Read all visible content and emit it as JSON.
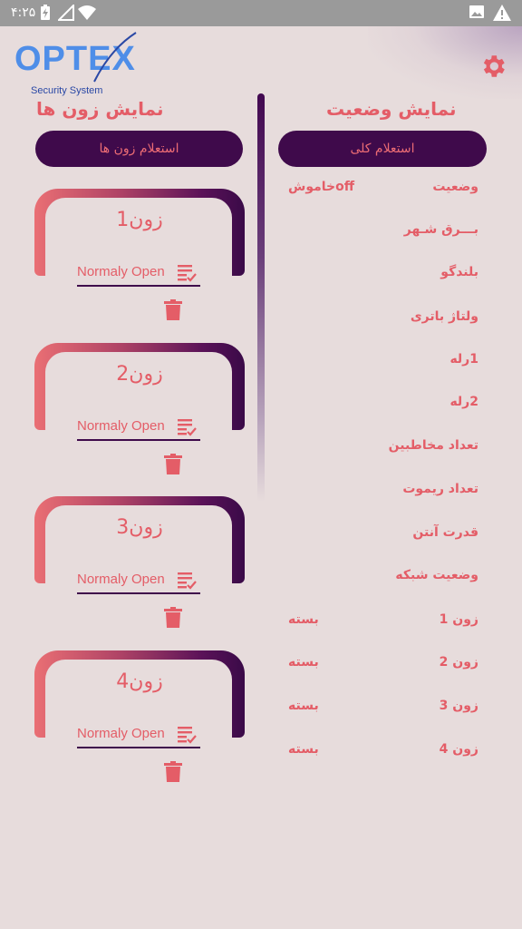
{
  "status_bar": {
    "time": "۴:۲۵"
  },
  "header": {
    "logo_text": "OPTEX",
    "logo_subtitle": "Security System",
    "settings_icon": "gear-icon"
  },
  "status_panel": {
    "title": "نمایش وضعیت",
    "inquiry_button": "استعلام کلی",
    "rows": [
      {
        "label": "وضعیت",
        "value": "offخاموش"
      },
      {
        "label": "بـــرق شـهر",
        "value": ""
      },
      {
        "label": "بلندگو",
        "value": ""
      },
      {
        "label": "ولتاژ باتری",
        "value": ""
      },
      {
        "label": "1رله",
        "value": ""
      },
      {
        "label": "2رله",
        "value": ""
      },
      {
        "label": "تعداد مخاطبین",
        "value": ""
      },
      {
        "label": "تعداد ریموت",
        "value": ""
      },
      {
        "label": "قدرت آنتن",
        "value": ""
      },
      {
        "label": "وضعیت شبکه",
        "value": ""
      },
      {
        "label": "زون 1",
        "value": "بسته"
      },
      {
        "label": "زون 2",
        "value": "بسته"
      },
      {
        "label": "زون 3",
        "value": "بسته"
      },
      {
        "label": "زون 4",
        "value": "بسته"
      }
    ]
  },
  "zones_panel": {
    "title": "نمایش زون ها",
    "inquiry_button": "استعلام زون ها",
    "zones": [
      {
        "name": "زون1",
        "mode": "Normaly Open"
      },
      {
        "name": "زون2",
        "mode": "Normaly Open"
      },
      {
        "name": "زون3",
        "mode": "Normaly Open"
      },
      {
        "name": "زون4",
        "mode": "Normaly Open"
      }
    ]
  },
  "colors": {
    "accent": "#e45d67",
    "primary": "#3f0a4b",
    "background": "#e7dcdc"
  }
}
